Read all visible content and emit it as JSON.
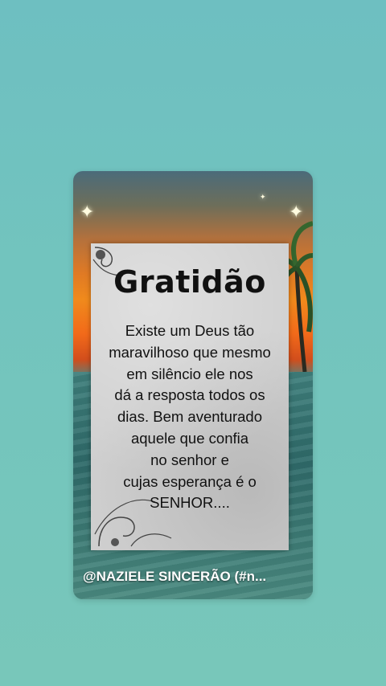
{
  "post": {
    "title": "Gratidão",
    "lines": [
      "Existe um Deus tão",
      "maravilhoso que mesmo",
      "em silêncio ele nos",
      "dá a resposta todos os",
      "dias. Bem aventurado",
      "aquele que confia",
      "no senhor e",
      "cujas esperança é o",
      "SENHOR...."
    ],
    "caption": "@NAZIELE SINCERÃO  (#n..."
  },
  "colors": {
    "background": "#72c4be",
    "sunset": "#f08a1c",
    "paper": "#cfcfcf",
    "caption_text": "#ffffff"
  },
  "icons": [
    "sparkle-icon",
    "palm-tree-icon",
    "swirl-ornament-icon"
  ]
}
